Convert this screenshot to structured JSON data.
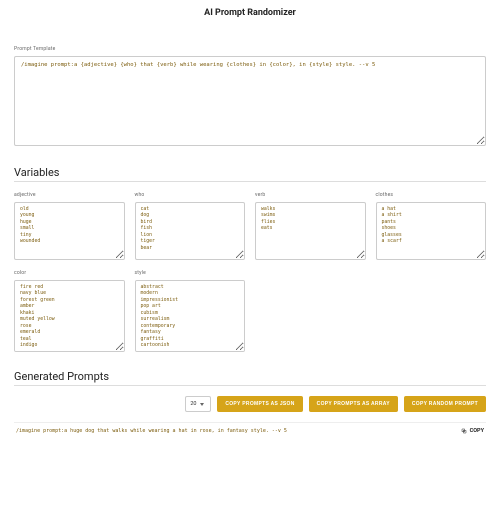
{
  "title": "AI Prompt Randomizer",
  "template": {
    "label": "Prompt Template",
    "value": "/imagine prompt:a {adjective} {who} that {verb} while wearing {clothes} in {color}, in {style} style. --v 5"
  },
  "variables_heading": "Variables",
  "variables_row1": [
    {
      "name": "adjective",
      "value": "old\nyoung\nhuge\nsmall\ntiny\nwounded"
    },
    {
      "name": "who",
      "value": "cat\ndog\nbird\nfish\nlion\ntiger\nbear"
    },
    {
      "name": "verb",
      "value": "walks\nswims\nflies\neats"
    },
    {
      "name": "clothes",
      "value": "a hat\na shirt\npants\nshoes\nglasses\na scarf"
    }
  ],
  "variables_row2": [
    {
      "name": "color",
      "value": "fire red\nnavy blue\nforest green\namber\nkhaki\nmuted yellow\nrose\nemerald\nteal\nindigo"
    },
    {
      "name": "style",
      "value": "abstract\nmodern\nimpressionist\npop art\ncubism\nsurrealism\ncontemporary\nfantasy\ngraffiti\ncartoonish"
    }
  ],
  "generated_heading": "Generated Prompts",
  "count_value": "20",
  "buttons": {
    "copy_json": "COPY PROMPTS AS JSON",
    "copy_array": "COPY PROMPTS AS ARRAY",
    "copy_random": "COPY RANDOM PROMPT"
  },
  "generated": [
    {
      "text": "/imagine prompt:a huge dog that walks while wearing a hat in rose, in fantasy style. --v 5",
      "copy_label": "COPY"
    }
  ]
}
